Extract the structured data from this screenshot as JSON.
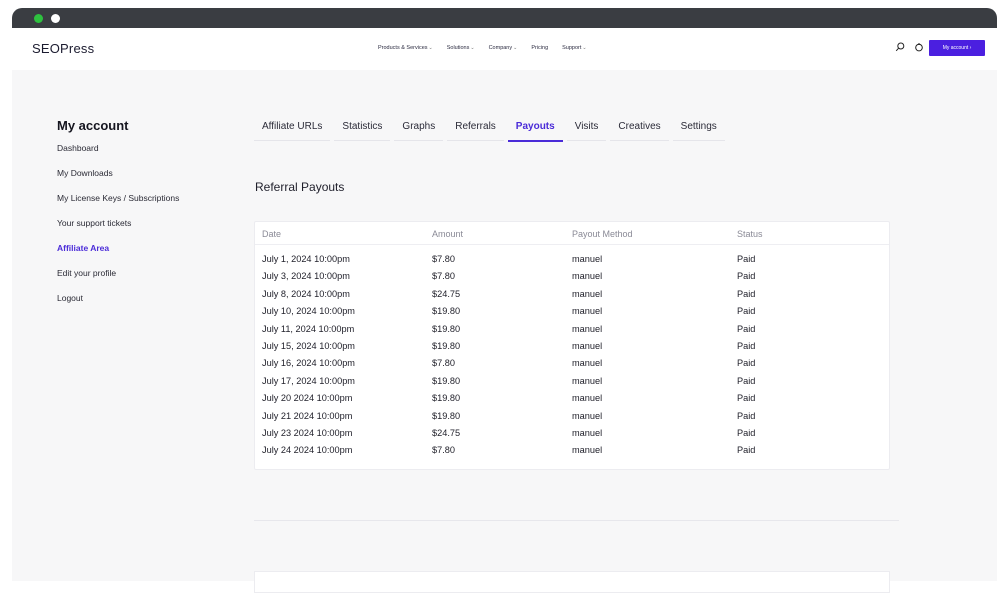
{
  "header": {
    "logo": "SEOPress",
    "nav": [
      {
        "label": "Products & Services",
        "caret": "⌄"
      },
      {
        "label": "Solutions",
        "caret": "⌄"
      },
      {
        "label": "Company",
        "caret": "⌄"
      },
      {
        "label": "Pricing",
        "caret": ""
      },
      {
        "label": "Support",
        "caret": "⌄"
      }
    ],
    "account_button": "My account ›",
    "icons": [
      "search-icon",
      "user-icon"
    ]
  },
  "sidebar": {
    "title": "My account",
    "items": [
      {
        "label": "Dashboard",
        "active": false
      },
      {
        "label": "My Downloads",
        "active": false
      },
      {
        "label": "My License Keys / Subscriptions",
        "active": false
      },
      {
        "label": "Your support tickets",
        "active": false
      },
      {
        "label": "Affiliate Area",
        "active": true
      },
      {
        "label": "Edit your profile",
        "active": false
      },
      {
        "label": "Logout",
        "active": false
      }
    ]
  },
  "tabs": [
    {
      "label": "Affiliate URLs",
      "active": false
    },
    {
      "label": "Statistics",
      "active": false
    },
    {
      "label": "Graphs",
      "active": false
    },
    {
      "label": "Referrals",
      "active": false
    },
    {
      "label": "Payouts",
      "active": true
    },
    {
      "label": "Visits",
      "active": false
    },
    {
      "label": "Creatives",
      "active": false
    },
    {
      "label": "Settings",
      "active": false
    }
  ],
  "section": {
    "title": "Referral Payouts"
  },
  "table": {
    "columns": [
      "Date",
      "Amount",
      "Payout Method",
      "Status"
    ],
    "rows": [
      [
        "July 1, 2024 10:00pm",
        "$7.80",
        "manuel",
        "Paid"
      ],
      [
        "July 3, 2024 10:00pm",
        "$7.80",
        "manuel",
        "Paid"
      ],
      [
        "July 8, 2024 10:00pm",
        "$24.75",
        "manuel",
        "Paid"
      ],
      [
        "July 10, 2024 10:00pm",
        "$19.80",
        "manuel",
        "Paid"
      ],
      [
        "July 11, 2024 10:00pm",
        "$19.80",
        "manuel",
        "Paid"
      ],
      [
        "July 15, 2024 10:00pm",
        "$19.80",
        "manuel",
        "Paid"
      ],
      [
        "July 16, 2024 10:00pm",
        "$7.80",
        "manuel",
        "Paid"
      ],
      [
        "July 17, 2024 10:00pm",
        "$19.80",
        "manuel",
        "Paid"
      ],
      [
        "July 20 2024 10:00pm",
        "$19.80",
        "manuel",
        "Paid"
      ],
      [
        "July 21 2024 10:00pm",
        "$19.80",
        "manuel",
        "Paid"
      ],
      [
        "July 23 2024 10:00pm",
        "$24.75",
        "manuel",
        "Paid"
      ],
      [
        "July 24 2024 10:00pm",
        "$7.80",
        "manuel",
        "Paid"
      ]
    ]
  },
  "colors": {
    "accent": "#4a2bd8",
    "button": "#4b1fe0",
    "titlebar": "#3a3d42"
  }
}
